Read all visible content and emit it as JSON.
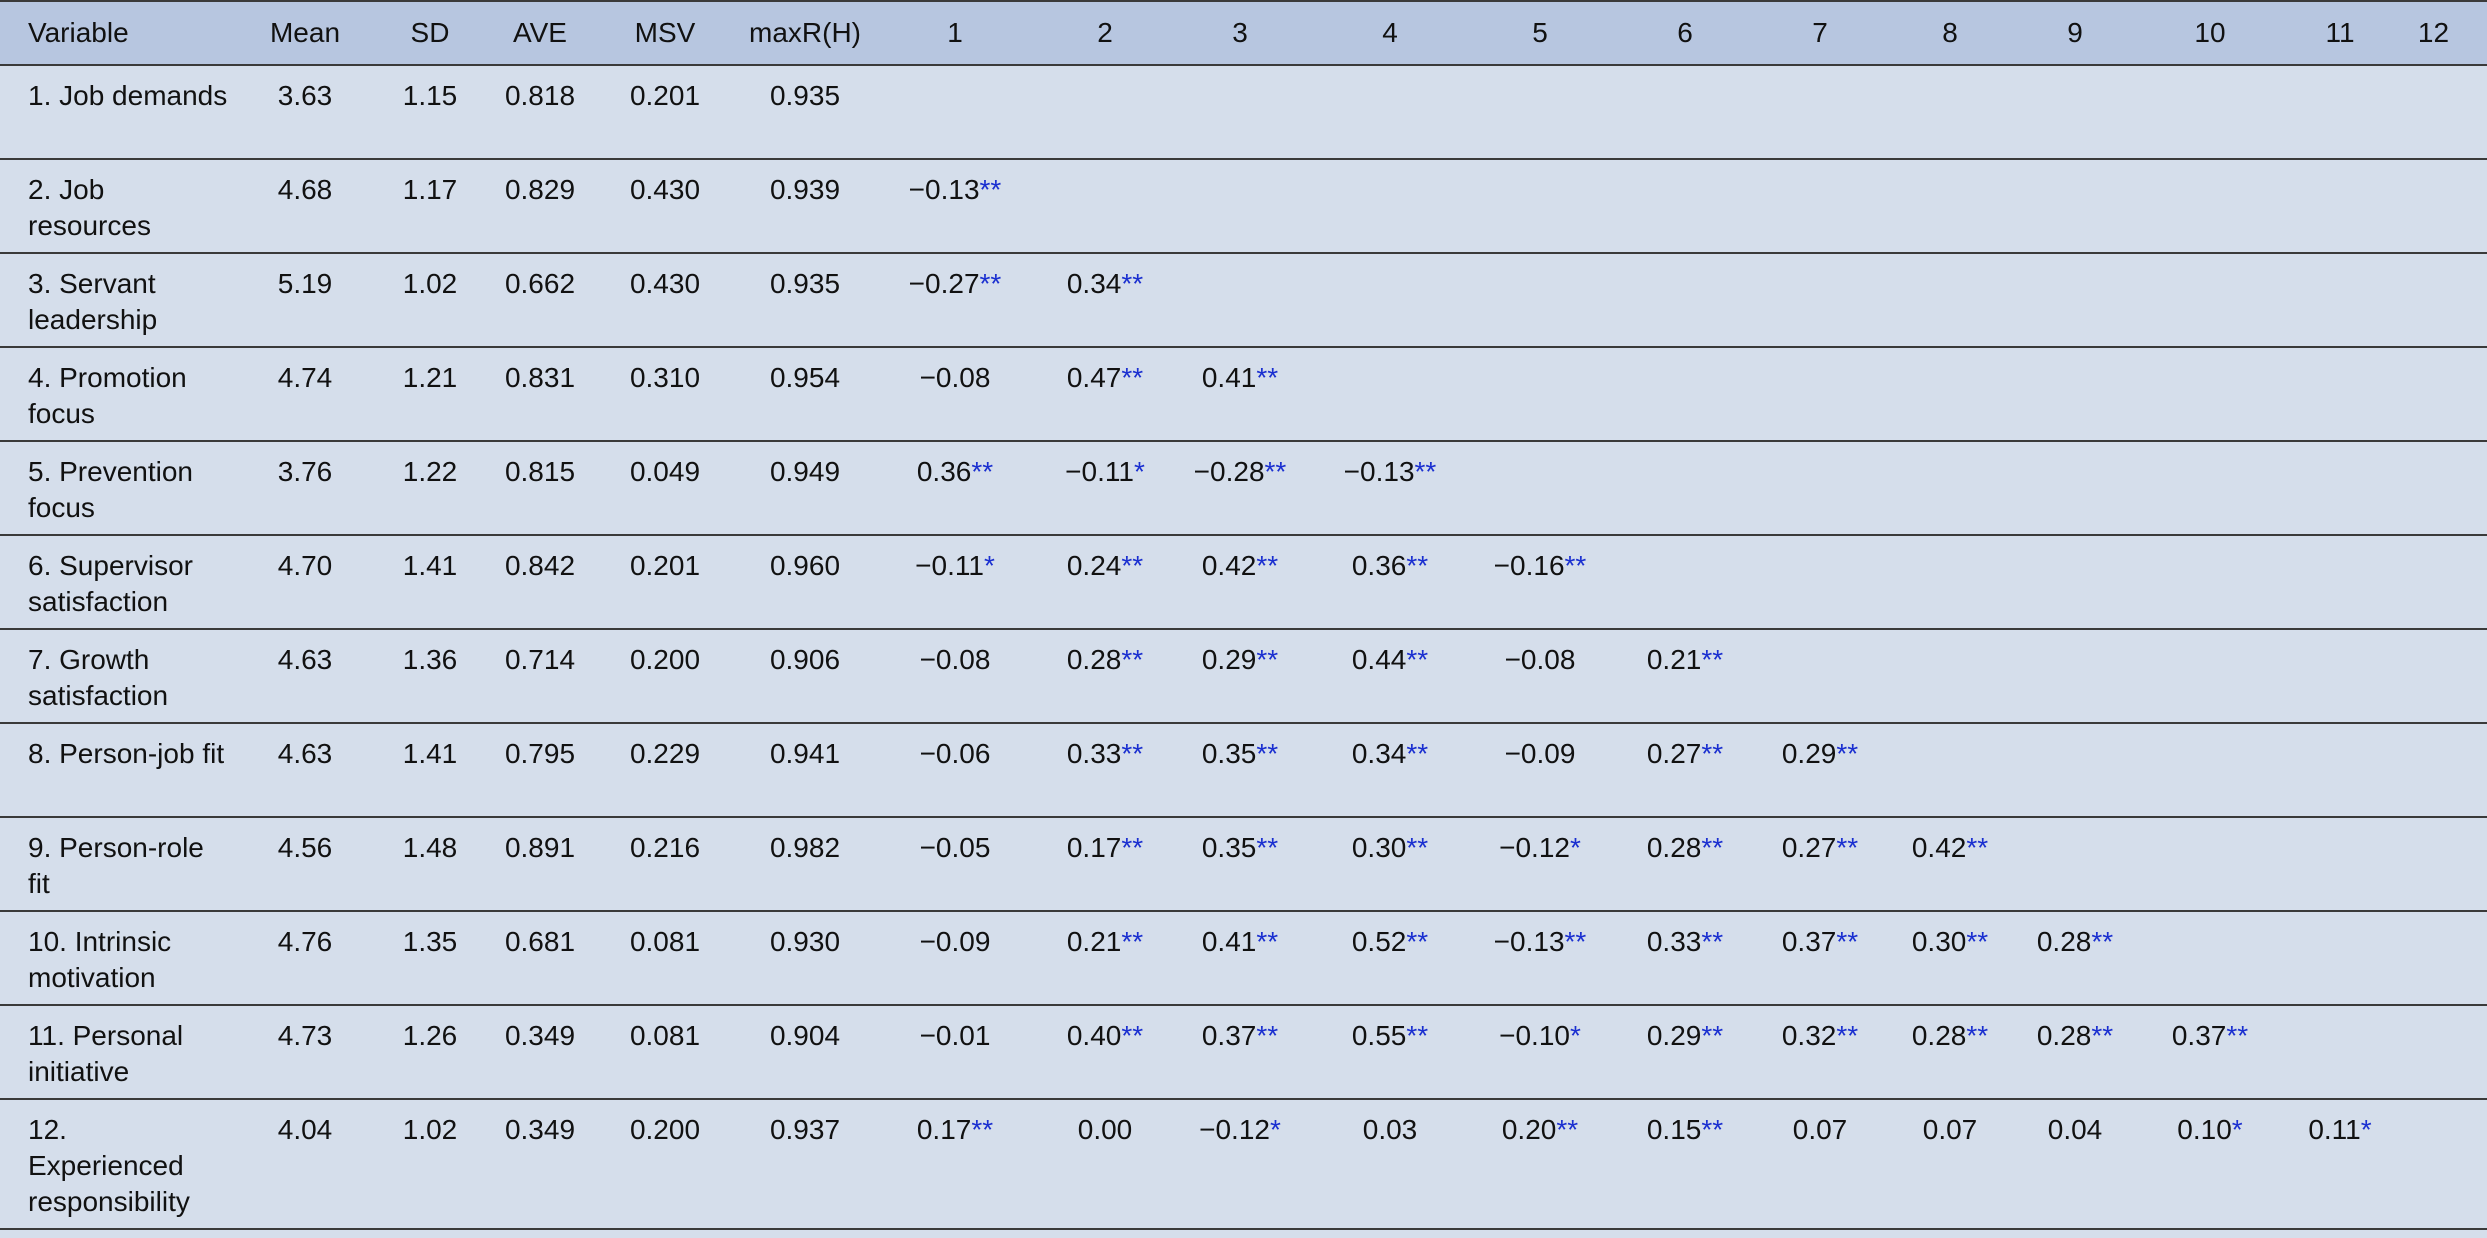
{
  "table": {
    "headers": [
      "Variable",
      "Mean",
      "SD",
      "AVE",
      "MSV",
      "maxR(H)",
      "1",
      "2",
      "3",
      "4",
      "5",
      "6",
      "7",
      "8",
      "9",
      "10",
      "11",
      "12"
    ],
    "rows": [
      {
        "variable": "1. Job demands",
        "stats": [
          "3.63",
          "1.15",
          "0.818",
          "0.201",
          "0.935"
        ],
        "corr": []
      },
      {
        "variable": "2. Job resources",
        "stats": [
          "4.68",
          "1.17",
          "0.829",
          "0.430",
          "0.939"
        ],
        "corr": [
          [
            "−0.13",
            "**"
          ]
        ]
      },
      {
        "variable": "3. Servant leadership",
        "stats": [
          "5.19",
          "1.02",
          "0.662",
          "0.430",
          "0.935"
        ],
        "corr": [
          [
            "−0.27",
            "**"
          ],
          [
            "0.34",
            "**"
          ]
        ]
      },
      {
        "variable": "4. Promotion focus",
        "stats": [
          "4.74",
          "1.21",
          "0.831",
          "0.310",
          "0.954"
        ],
        "corr": [
          [
            "−0.08",
            ""
          ],
          [
            "0.47",
            "**"
          ],
          [
            "0.41",
            "**"
          ]
        ]
      },
      {
        "variable": "5. Prevention focus",
        "stats": [
          "3.76",
          "1.22",
          "0.815",
          "0.049",
          "0.949"
        ],
        "corr": [
          [
            "0.36",
            "**"
          ],
          [
            "−0.11",
            "*"
          ],
          [
            "−0.28",
            "**"
          ],
          [
            "−0.13",
            "**"
          ]
        ]
      },
      {
        "variable": "6. Supervisor satisfaction",
        "stats": [
          "4.70",
          "1.41",
          "0.842",
          "0.201",
          "0.960"
        ],
        "corr": [
          [
            "−0.11",
            "*"
          ],
          [
            "0.24",
            "**"
          ],
          [
            "0.42",
            "**"
          ],
          [
            "0.36",
            "**"
          ],
          [
            "−0.16",
            "**"
          ]
        ]
      },
      {
        "variable": "7. Growth satisfaction",
        "stats": [
          "4.63",
          "1.36",
          "0.714",
          "0.200",
          "0.906"
        ],
        "corr": [
          [
            "−0.08",
            ""
          ],
          [
            "0.28",
            "**"
          ],
          [
            "0.29",
            "**"
          ],
          [
            "0.44",
            "**"
          ],
          [
            "−0.08",
            ""
          ],
          [
            "0.21",
            "**"
          ]
        ]
      },
      {
        "variable": "8. Person-job fit",
        "stats": [
          "4.63",
          "1.41",
          "0.795",
          "0.229",
          "0.941"
        ],
        "corr": [
          [
            "−0.06",
            ""
          ],
          [
            "0.33",
            "**"
          ],
          [
            "0.35",
            "**"
          ],
          [
            "0.34",
            "**"
          ],
          [
            "−0.09",
            ""
          ],
          [
            "0.27",
            "**"
          ],
          [
            "0.29",
            "**"
          ]
        ]
      },
      {
        "variable": "9. Person-role fit",
        "stats": [
          "4.56",
          "1.48",
          "0.891",
          "0.216",
          "0.982"
        ],
        "corr": [
          [
            "−0.05",
            ""
          ],
          [
            "0.17",
            "**"
          ],
          [
            "0.35",
            "**"
          ],
          [
            "0.30",
            "**"
          ],
          [
            "−0.12",
            "*"
          ],
          [
            "0.28",
            "**"
          ],
          [
            "0.27",
            "**"
          ],
          [
            "0.42",
            "**"
          ]
        ]
      },
      {
        "variable": "10. Intrinsic motivation",
        "stats": [
          "4.76",
          "1.35",
          "0.681",
          "0.081",
          "0.930"
        ],
        "corr": [
          [
            "−0.09",
            ""
          ],
          [
            "0.21",
            "**"
          ],
          [
            "0.41",
            "**"
          ],
          [
            "0.52",
            "**"
          ],
          [
            "−0.13",
            "**"
          ],
          [
            "0.33",
            "**"
          ],
          [
            "0.37",
            "**"
          ],
          [
            "0.30",
            "**"
          ],
          [
            "0.28",
            "**"
          ]
        ]
      },
      {
        "variable": "11. Personal initiative",
        "stats": [
          "4.73",
          "1.26",
          "0.349",
          "0.081",
          "0.904"
        ],
        "corr": [
          [
            "−0.01",
            ""
          ],
          [
            "0.40",
            "**"
          ],
          [
            "0.37",
            "**"
          ],
          [
            "0.55",
            "**"
          ],
          [
            "−0.10",
            "*"
          ],
          [
            "0.29",
            "**"
          ],
          [
            "0.32",
            "**"
          ],
          [
            "0.28",
            "**"
          ],
          [
            "0.28",
            "**"
          ],
          [
            "0.37",
            "**"
          ]
        ]
      },
      {
        "variable": "12. Experienced responsibility",
        "stats": [
          "4.04",
          "1.02",
          "0.349",
          "0.200",
          "0.937"
        ],
        "corr": [
          [
            "0.17",
            "**"
          ],
          [
            "0.00",
            ""
          ],
          [
            "−0.12",
            "*"
          ],
          [
            "0.03",
            ""
          ],
          [
            "0.20",
            "**"
          ],
          [
            "0.15",
            "**"
          ],
          [
            "0.07",
            ""
          ],
          [
            "0.07",
            ""
          ],
          [
            "0.04",
            ""
          ],
          [
            "0.10",
            "*"
          ],
          [
            "0.11",
            "*"
          ]
        ]
      }
    ]
  }
}
